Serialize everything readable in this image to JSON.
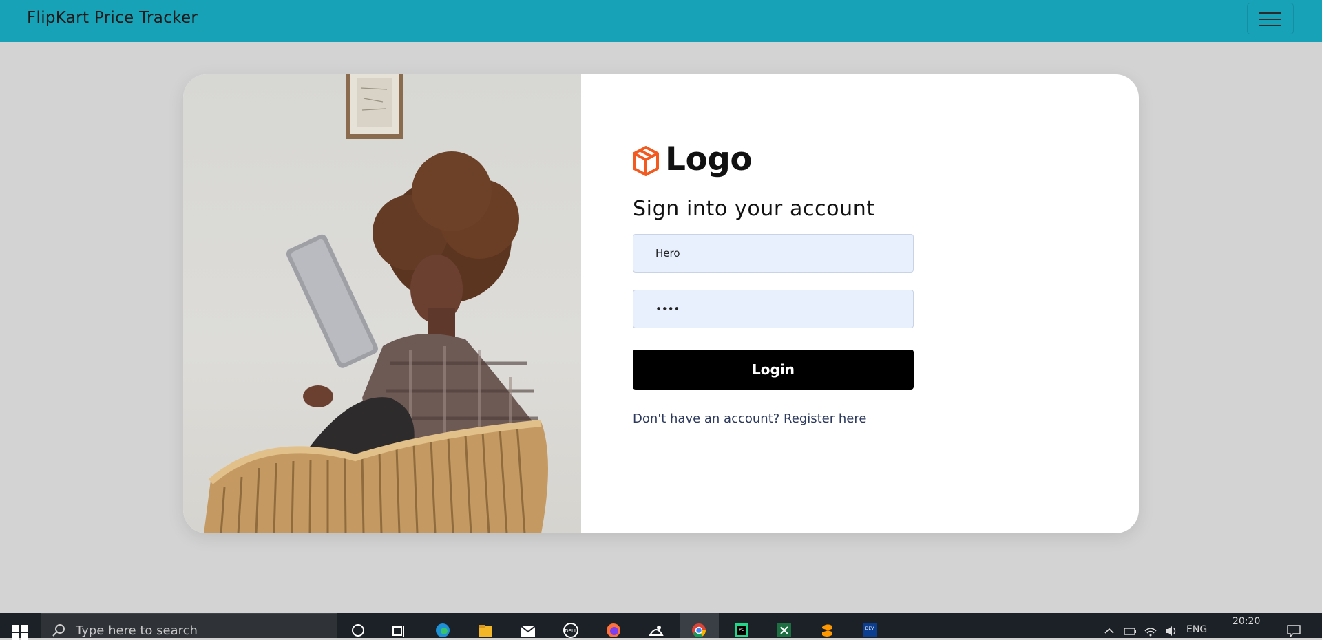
{
  "navbar": {
    "brand": "FlipKart Price Tracker",
    "menu_icon": "hamburger-menu-icon"
  },
  "login": {
    "logo_text": "Logo",
    "logo_icon": "cube-logo-icon",
    "heading": "Sign into your account",
    "username_value": "Hero",
    "password_value": "••••",
    "login_label": "Login",
    "register_text": "Don't have an account? Register here"
  },
  "taskbar": {
    "search_placeholder": "Type here to search",
    "language": "ENG",
    "time": "20:20",
    "pinned_apps": [
      "cortana-icon",
      "task-view-icon",
      "edge-icon",
      "file-explorer-icon",
      "mail-icon",
      "dell-icon",
      "firefox-icon",
      "photos-icon",
      "chrome-icon",
      "pycharm-icon",
      "excel-icon",
      "sublime-icon",
      "dev-icon"
    ]
  },
  "colors": {
    "navbar_bg": "#17a2b8",
    "page_bg": "#d3d3d3",
    "button_bg": "#000000",
    "input_bg": "#e8f0fe",
    "logo_accent": "#f35a1f"
  }
}
